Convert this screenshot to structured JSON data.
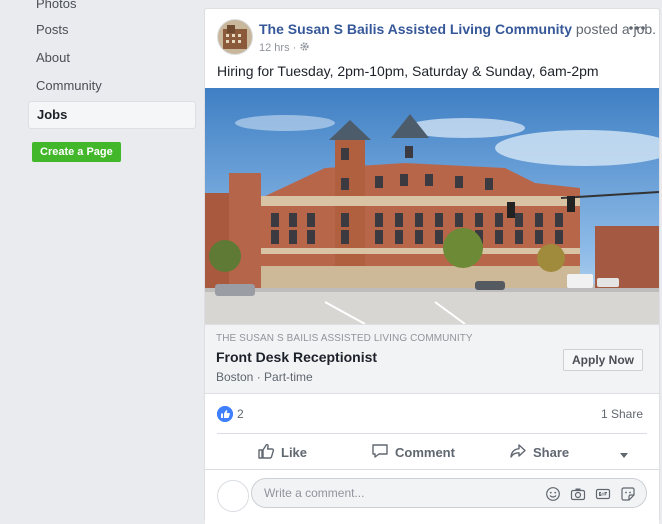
{
  "sidebar": {
    "items": [
      {
        "label": "Photos"
      },
      {
        "label": "Posts"
      },
      {
        "label": "About"
      },
      {
        "label": "Community"
      },
      {
        "label": "Jobs"
      }
    ],
    "create_page_label": "Create a Page"
  },
  "post": {
    "author": "The Susan S Bailis Assisted Living Community",
    "action": "posted a job.",
    "time": "12 hrs",
    "privacy_icon": "gear-icon",
    "text": "Hiring for Tuesday, 2pm-10pm, Saturday & Sunday, 6am-2pm"
  },
  "job": {
    "company": "THE SUSAN S BAILIS ASSISTED LIVING COMMUNITY",
    "title": "Front Desk Receptionist",
    "location": "Boston · Part-time",
    "apply_label": "Apply Now"
  },
  "engagement": {
    "reaction_count": "2",
    "share_count": "1 Share"
  },
  "actions": {
    "like": "Like",
    "comment": "Comment",
    "share": "Share"
  },
  "comment_box": {
    "placeholder": "Write a comment..."
  },
  "colors": {
    "link": "#365899",
    "create_page_bg": "#42b72a",
    "like_badge": "#4080ff"
  }
}
